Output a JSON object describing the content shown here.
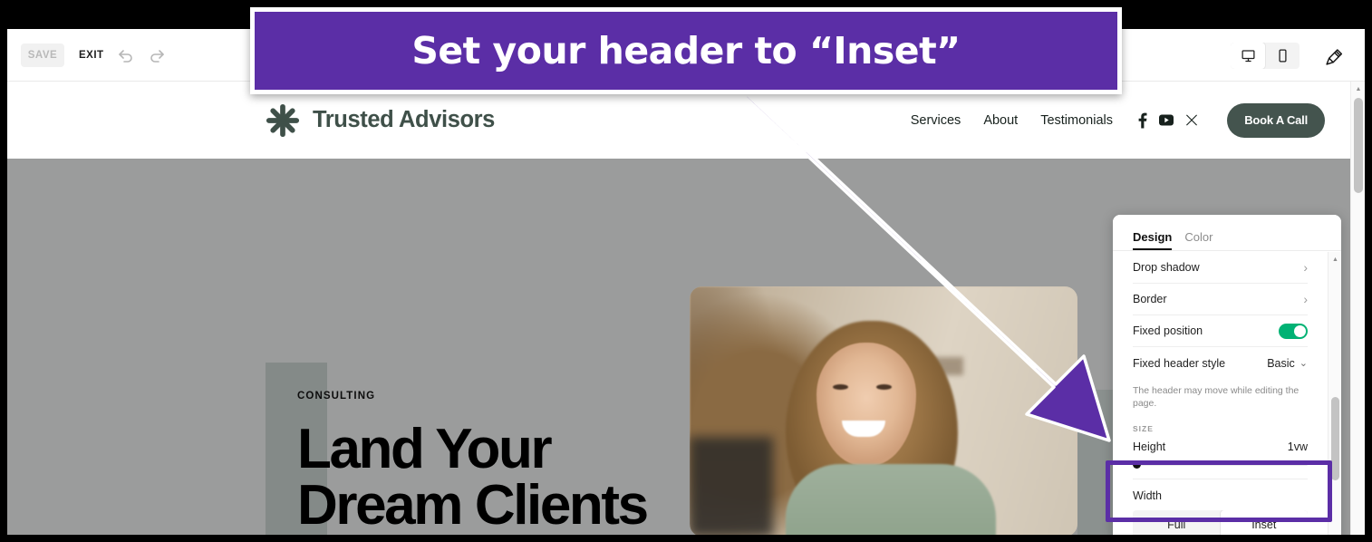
{
  "annotation": {
    "banner_text": "Set your header to “Inset”",
    "banner_color": "#5b2ea6",
    "arrow_color": "#5b2ea6",
    "highlight_color": "#5b2ea6"
  },
  "toolbar": {
    "save_label": "SAVE",
    "exit_label": "EXIT",
    "undo_icon": "undo-arrow-icon",
    "redo_icon": "redo-arrow-icon",
    "desktop_icon": "desktop-monitor-icon",
    "mobile_icon": "mobile-phone-icon",
    "brush_icon": "paintbrush-icon",
    "active_device": "desktop"
  },
  "site_header": {
    "logo_text": "Trusted Advisors",
    "logo_icon": "asterisk-flower-logo-icon",
    "logo_color": "#3f5049",
    "nav_links": [
      "Services",
      "About",
      "Testimonials"
    ],
    "social": [
      {
        "name": "facebook-icon",
        "label": "f"
      },
      {
        "name": "youtube-icon",
        "label": "YouTube"
      },
      {
        "name": "x-twitter-icon",
        "label": "X"
      }
    ],
    "cta_label": "Book A Call",
    "cta_color": "#44544e"
  },
  "hero": {
    "eyebrow": "CONSULTING",
    "title_line1": "Land Your",
    "title_line2": "Dream Clients",
    "background_color": "#9b9c9c",
    "photo_alt": "smiling-woman-photo"
  },
  "design_panel": {
    "tabs": [
      {
        "label": "Design",
        "active": true
      },
      {
        "label": "Color",
        "active": false
      }
    ],
    "rows": [
      {
        "label": "Drop shadow",
        "control": "chevron",
        "value": "›"
      },
      {
        "label": "Border",
        "control": "chevron",
        "value": "›"
      },
      {
        "label": "Fixed position",
        "control": "toggle",
        "value": "on"
      },
      {
        "label": "Fixed header style",
        "control": "select",
        "value": "Basic"
      }
    ],
    "helper_note": "The header may move while editing the page.",
    "size_section_label": "SIZE",
    "height_label": "Height",
    "height_value": "1vw",
    "height_slider_position": 0,
    "width_label": "Width",
    "width_options": [
      {
        "label": "Full",
        "selected": false
      },
      {
        "label": "Inset",
        "selected": true
      }
    ],
    "toggle_on_color": "#00b274"
  }
}
